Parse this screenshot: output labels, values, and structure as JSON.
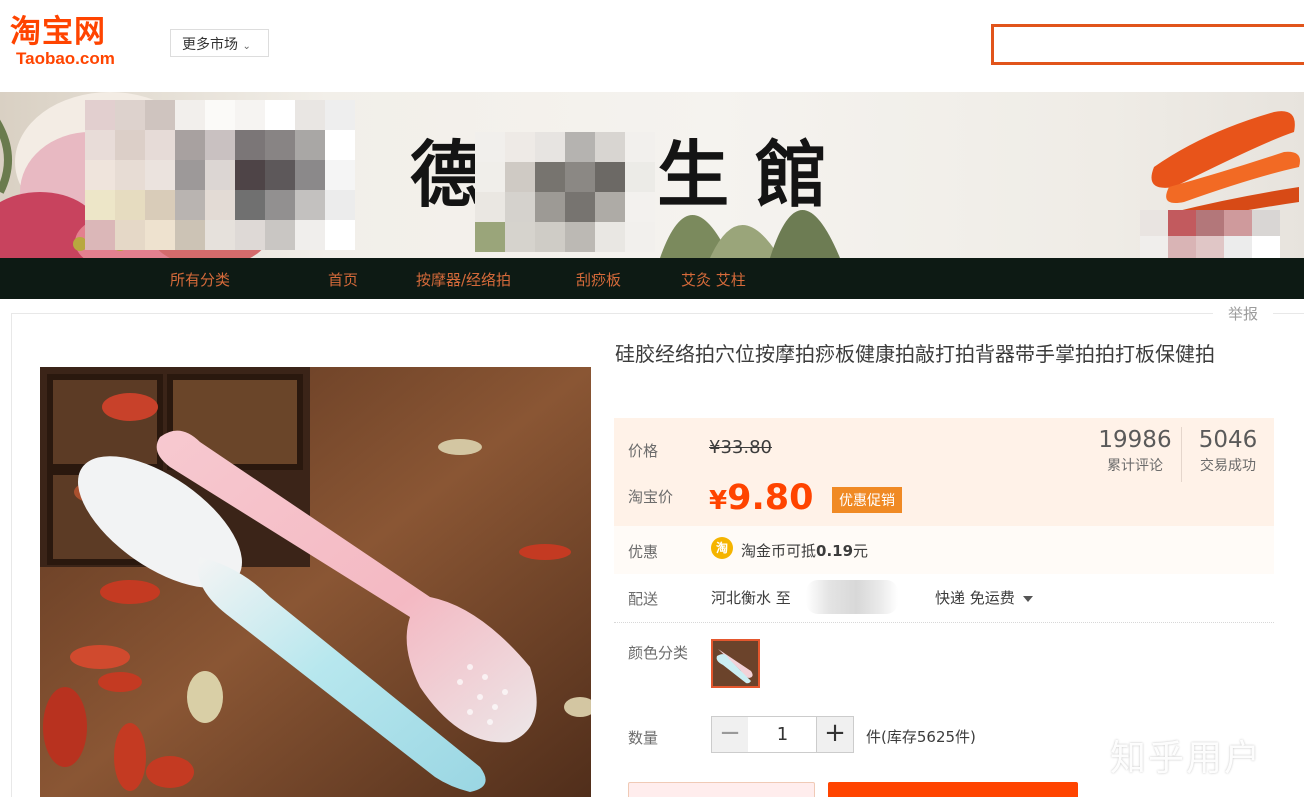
{
  "header": {
    "logo_cn": "淘宝网",
    "logo_en": "Taobao.com",
    "more_markets": "更多市场",
    "search_value": ""
  },
  "shop": {
    "banner_title": "德  養生館",
    "nav": [
      "所有分类",
      "首页",
      "按摩器/经络拍",
      "刮痧板",
      "艾灸 艾柱"
    ],
    "report": "举报"
  },
  "product": {
    "title": "硅胶经络拍穴位按摩拍痧板健康拍敲打拍背器带手掌拍拍打板保健拍",
    "price_label": "价格",
    "original_price": "¥33.80",
    "taobao_price_label": "淘宝价",
    "current_price_symbol": "¥",
    "current_price": "9.80",
    "promo_tag": "优惠促销",
    "stats": [
      {
        "value": "19986",
        "label": "累计评论"
      },
      {
        "value": "5046",
        "label": "交易成功"
      }
    ],
    "promo_label": "优惠",
    "coin_icon": "淘",
    "coin_text_prefix": "淘金币可抵",
    "coin_amount": "0.19",
    "coin_text_suffix": "元",
    "delivery_label": "配送",
    "delivery_from": "河北衡水 至",
    "shipping": "快递 免运费",
    "color_label": "颜色分类",
    "quantity_label": "数量",
    "quantity_value": "1",
    "minus": "−",
    "plus": "+",
    "stock_text": "件(库存5625件)"
  },
  "watermark": "知乎用户",
  "colors": {
    "brand": "#ff4400",
    "nav_bg": "#0d1a14",
    "price_bg": "#fff2e8",
    "promo_tag": "#f08a24"
  }
}
